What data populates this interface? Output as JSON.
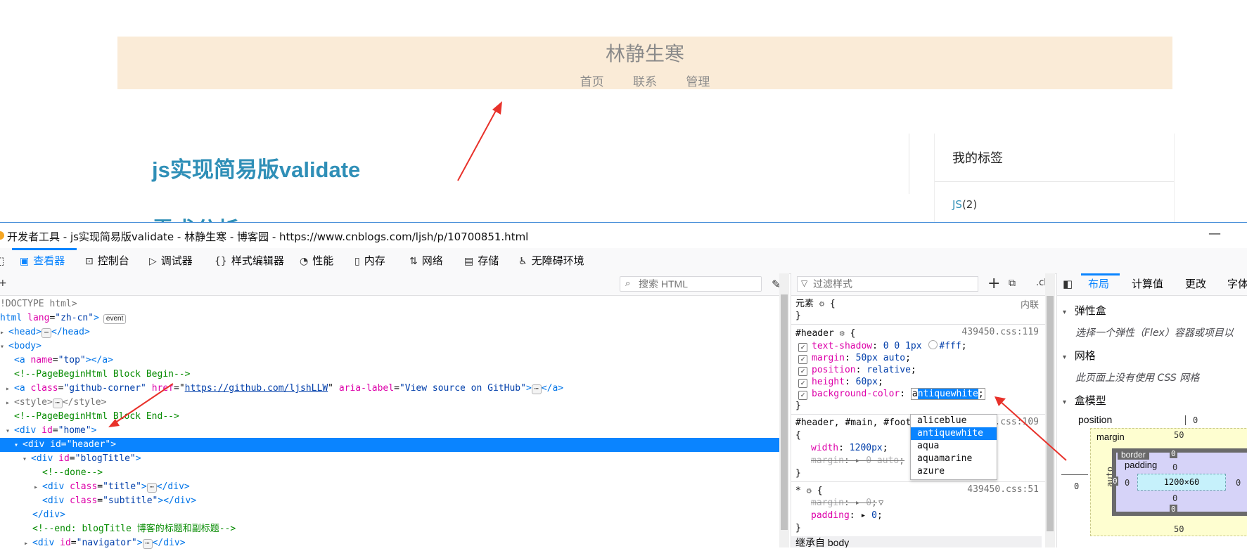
{
  "blog": {
    "title": "林静生寒",
    "nav": [
      "首页",
      "联系",
      "管理"
    ],
    "post_title": "js实现简易版validate",
    "post_title_2": "需求分析",
    "sidebar_heading": "我的标签",
    "tag_name": "JS",
    "tag_count": "(2)"
  },
  "devtools": {
    "window_title": "开发者工具 - js实现简易版validate - 林静生寒 - 博客园 - https://www.cnblogs.com/ljsh/p/10700851.html",
    "minimize": "—",
    "tabs": [
      {
        "label": "查看器",
        "icon": "inspector-icon"
      },
      {
        "label": "控制台",
        "icon": "console-icon"
      },
      {
        "label": "调试器",
        "icon": "debugger-icon"
      },
      {
        "label": "样式编辑器",
        "icon": "style-editor-icon"
      },
      {
        "label": "性能",
        "icon": "performance-icon"
      },
      {
        "label": "内存",
        "icon": "memory-icon"
      },
      {
        "label": "网络",
        "icon": "network-icon"
      },
      {
        "label": "存储",
        "icon": "storage-icon"
      },
      {
        "label": "无障碍环境",
        "icon": "accessibility-icon"
      }
    ],
    "search_html_placeholder": "搜索 HTML",
    "filter_styles_placeholder": "过滤样式",
    "cls": ".cls",
    "html_tree": {
      "doctype": "!DOCTYPE html>",
      "html_open_tag": "html",
      "html_lang_attr": "lang",
      "html_lang_val": "\"zh-cn\"",
      "event_badge": "event",
      "head_open": "<head>",
      "head_close": "</head>",
      "body_open": "<body>",
      "a_top_tag": "<a",
      "a_top_attr": "name",
      "a_top_val": "\"top\"",
      "a_top_close": "></a>",
      "comment_begin": "<!--PageBeginHtml Block Begin-->",
      "gh_tag": "<a",
      "gh_class_attr": "class",
      "gh_class_val": "\"github-corner\"",
      "gh_href_attr": "href",
      "gh_href_val": "https://github.com/ljshLLW",
      "gh_aria_attr": "aria-label",
      "gh_aria_val": "\"View source on GitHub\"",
      "gh_close": "</a>",
      "style_open": "<style>",
      "style_close": "</style>",
      "comment_end": "<!--PageBeginHtml Block End-->",
      "home_tag": "<div",
      "home_attr": "id",
      "home_val": "\"home\"",
      "header_tag": "<div",
      "header_attr": "id",
      "header_val": "\"header\"",
      "blogtitle_tag": "<div",
      "blogtitle_attr": "id",
      "blogtitle_val": "\"blogTitle\"",
      "comment_done": "<!--done-->",
      "title_tag": "<div",
      "title_attr": "class",
      "title_val": "\"title\"",
      "title_close": "</div>",
      "subtitle_tag": "<div",
      "subtitle_attr": "class",
      "subtitle_val": "\"subtitle\"",
      "subtitle_close": "></div>",
      "div_close": "</div>",
      "comment_blogtitle_end": "<!--end: blogTitle 博客的标题和副标题-->",
      "nav_tag": "<div",
      "nav_attr": "id",
      "nav_val": "\"navigator\"",
      "nav_close": "</div>"
    },
    "rules": {
      "element_label": "元素",
      "inline_label": "内联",
      "rule1_selector": "#header",
      "rule1_source": "439450.css:119",
      "rule1_props": [
        {
          "name": "text-shadow",
          "value": "0 0 1px",
          "extra": "#fff"
        },
        {
          "name": "margin",
          "value": "50px auto"
        },
        {
          "name": "position",
          "value": "relative"
        },
        {
          "name": "height",
          "value": "60px"
        },
        {
          "name": "background-color",
          "value_prefix": "a",
          "value_highlight": "ntiquewhite"
        }
      ],
      "autocomplete": [
        "aliceblue",
        "antiquewhite",
        "aqua",
        "aquamarine",
        "azure"
      ],
      "rule2_selector": "#header, #main, #foot",
      "rule2_source": ".css:109",
      "rule2_props": [
        {
          "name": "width",
          "value": "1200px"
        },
        {
          "name": "margin",
          "value": "0 auto"
        }
      ],
      "rule3_selector": "*",
      "rule3_source": "439450.css:51",
      "rule3_props": [
        {
          "name": "margin",
          "value": "0"
        },
        {
          "name": "padding",
          "value": "0"
        }
      ],
      "inherited_label": "继承自 body"
    },
    "layout": {
      "tabs": [
        "布局",
        "计算值",
        "更改",
        "字体"
      ],
      "flex_heading": "弹性盒",
      "flex_note": "选择一个弹性（Flex）容器或项目以",
      "grid_heading": "网格",
      "grid_note": "此页面上没有使用 CSS 网格",
      "boxmodel_heading": "盒模型",
      "position_label": "position",
      "position_value": "0",
      "margin_label": "margin",
      "margin_top": "50",
      "margin_bottom": "50",
      "margin_left": "auto",
      "outer_left": "0",
      "border_label": "border",
      "border_top": "0",
      "border_bottom": "0",
      "border_left": "0",
      "padding_label": "padding",
      "padding_top": "0",
      "padding_bottom": "0",
      "padding_left": "0",
      "padding_right": "0",
      "content_size": "1200×60"
    }
  },
  "colors": {
    "header_bg": "#faebd7",
    "link_blue": "#2f8fb7",
    "devtools_accent": "#0a84ff",
    "arrow_red": "#e8312a"
  }
}
